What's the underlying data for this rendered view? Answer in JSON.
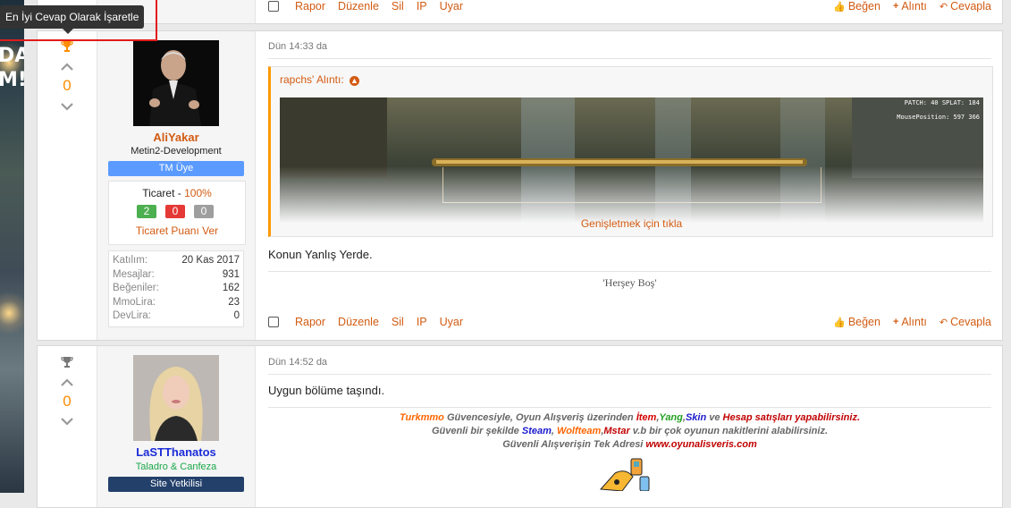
{
  "tooltip": {
    "text": "En İyi Cevap Olarak İşaretle"
  },
  "banner": {
    "text1": "DA",
    "text2": "M!"
  },
  "actions": {
    "report": "Rapor",
    "edit": "Düzenle",
    "delete": "Sil",
    "ip": "IP",
    "warn": "Uyar",
    "like": "Beğen",
    "quote": "Alıntı",
    "reply": "Cevapla"
  },
  "posts": [
    {
      "score": "0",
      "user": {
        "name": "AliYakar",
        "title": "Metin2-Development",
        "badge": "TM Üye",
        "name_color": "#d25b12",
        "badge_color": "#5b9bff",
        "trade": {
          "label": "Ticaret - ",
          "percent": "100%",
          "positive": "2",
          "negative": "0",
          "neutral": "0",
          "give_rating": "Ticaret Puanı Ver"
        },
        "stats": [
          {
            "k": "Katılım:",
            "v": "20 Kas 2017"
          },
          {
            "k": "Mesajlar:",
            "v": "931"
          },
          {
            "k": "Beğeniler:",
            "v": "162"
          },
          {
            "k": "MmoLira:",
            "v": "23"
          },
          {
            "k": "DevLira:",
            "v": "0"
          }
        ]
      },
      "date": "Dün 14:33 da",
      "quote": {
        "author": "rapchs' Alıntı:",
        "expand": "Genişletmek için tıkla",
        "overlay1": "PATCH: 40 SPLAT: 184",
        "overlay2": "MousePosition: 597 366"
      },
      "message": "Konun Yanlış Yerde.",
      "signature": "'Herşey Boş'"
    },
    {
      "score": "0",
      "user": {
        "name": "LaSTThanatos",
        "title": "Taladro & Canfeza",
        "badge": "Site Yetkilisi",
        "name_color": "#1b2bd8",
        "title_color": "#1aa84a",
        "badge_color": "#23406b"
      },
      "date": "Dün 14:52 da",
      "message": "Uygun bölüme taşındı.",
      "signature": {
        "l1": [
          {
            "t": "Turkmmo",
            "c": "#ff6600"
          },
          {
            "t": " Güvencesiyle, Oyun Alışveriş üzerinden ",
            "c": "#666666"
          },
          {
            "t": "İtem",
            "c": "#d40000"
          },
          {
            "t": ",",
            "c": "#666666"
          },
          {
            "t": "Yang",
            "c": "#22a022"
          },
          {
            "t": ",",
            "c": "#666666"
          },
          {
            "t": "Skin",
            "c": "#1a1acc"
          },
          {
            "t": " ve ",
            "c": "#666666"
          },
          {
            "t": "Hesap satışları yapabilirsiniz.",
            "c": "#c00000"
          }
        ],
        "l2": [
          {
            "t": "Güvenli bir şekilde ",
            "c": "#666666"
          },
          {
            "t": "Steam",
            "c": "#1a1acc"
          },
          {
            "t": ", ",
            "c": "#666666"
          },
          {
            "t": "Wolfteam",
            "c": "#ff6600"
          },
          {
            "t": ",",
            "c": "#666666"
          },
          {
            "t": "Mstar",
            "c": "#c00000"
          },
          {
            "t": " v.b bir çok oyunun nakitlerini alabilirsiniz.",
            "c": "#666666"
          }
        ],
        "l3": [
          {
            "t": "Güvenli Alışverişin Tek Adresi ",
            "c": "#666666"
          },
          {
            "t": "www.oyunalisveris.com",
            "c": "#c00000"
          }
        ]
      }
    }
  ]
}
